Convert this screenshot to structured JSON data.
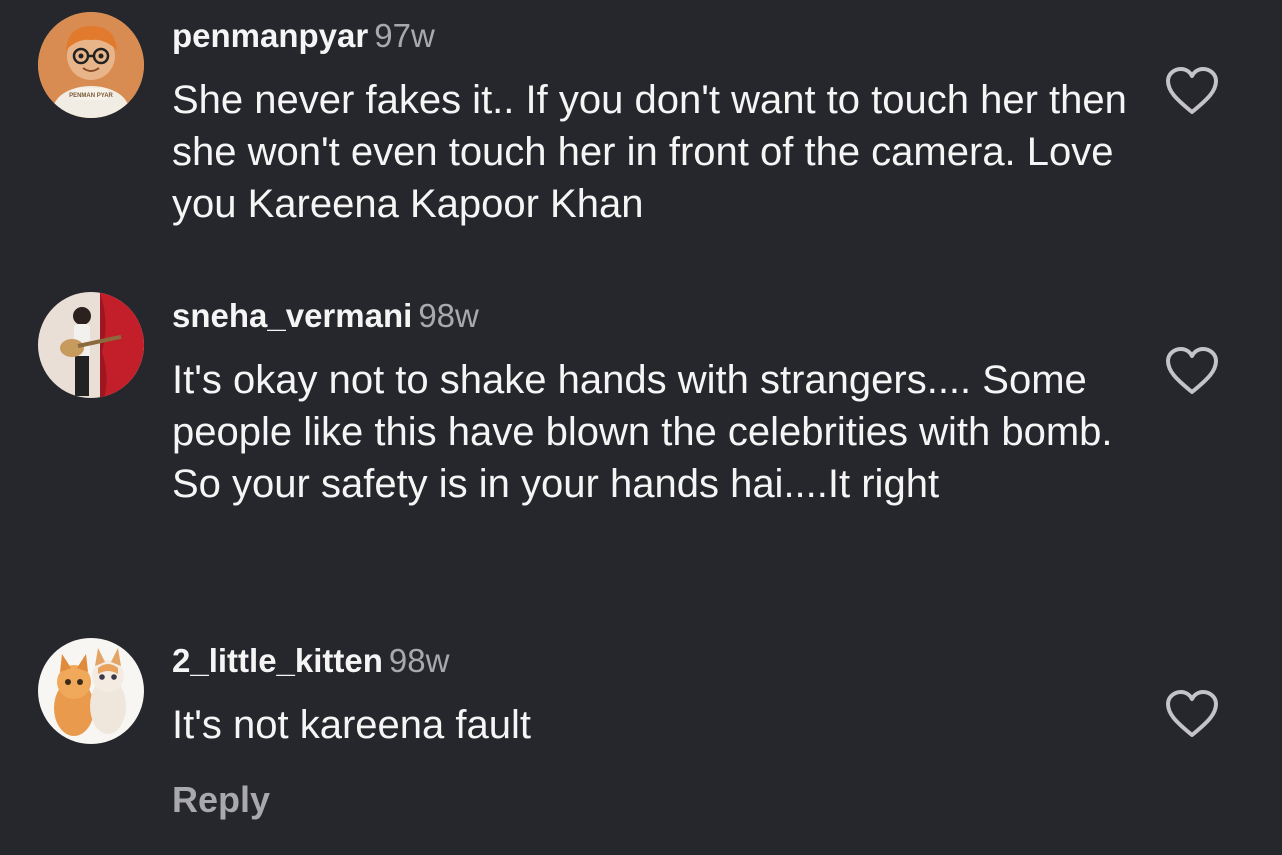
{
  "colors": {
    "background": "#26272c",
    "primary_text": "#f5f5f5",
    "secondary_text": "#a8a8ad"
  },
  "comments": [
    {
      "username": "penmanpyar",
      "time": "97w",
      "text": "She never fakes it.. If you don't want to touch her then she won't even touch her in front of the camera. Love you Kareena Kapoor Khan",
      "avatar": "cartoon-boy-avatar",
      "avatar_badge": "PENMAN PYAR",
      "like_icon": "heart-outline-icon"
    },
    {
      "username": "sneha_vermani",
      "time": "98w",
      "text": "It's okay not to shake hands with strangers.... Some people like this have blown the celebrities with bomb. So your safety is in your hands hai....It right",
      "avatar": "girl-with-guitar-avatar",
      "like_icon": "heart-outline-icon"
    },
    {
      "username": "2_little_kitten",
      "time": "98w",
      "text": "It's not kareena fault",
      "avatar": "two-kittens-avatar",
      "like_icon": "heart-outline-icon"
    }
  ],
  "reply_label": "Reply"
}
